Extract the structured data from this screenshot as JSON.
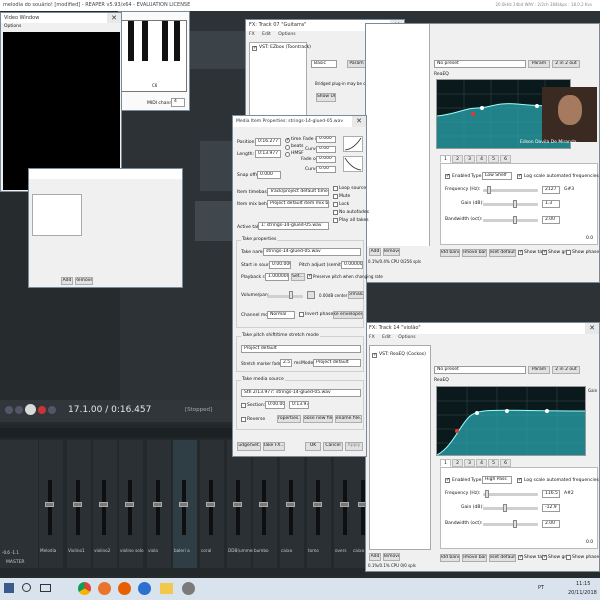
{
  "reaper_title": "melodia do souário! [modified] - REAPER v5.93/x64 - EVALUATION LICENSE",
  "reaper_status_right": "20.0kHz 24bit WAV : 2/2ch 384kbps : 18.0.2 Kvs",
  "video_window": {
    "title": "Video Window",
    "menu": "Options"
  },
  "midi_window": {
    "channel_label": "MIDI channel:",
    "channel_value": "4",
    "key_label": "C6"
  },
  "small_panel": {
    "add": "Add",
    "remove": "Remove"
  },
  "transport": {
    "position": "17.1.00 / 0:16.457",
    "state": "[Stopped]"
  },
  "mixer": {
    "tracks": [
      "Melodia",
      "Violino1",
      "violino2",
      "violino solo",
      "viola",
      "baleri a",
      "coral",
      "DDB(ummer",
      "bumbo",
      "caixa",
      "tomo",
      "overs",
      "caixa"
    ],
    "master_label": "MASTER",
    "master_db": "-0.6 -1.1"
  },
  "fx1": {
    "title": "FX: Track 07 \"Guitarra\"",
    "menu": [
      "FX",
      "Edit",
      "Options"
    ],
    "plugin": "VST: EZbox (Toontrack)",
    "preset": "Basic",
    "param_btn": "Param",
    "io_btn": "2 in 2 out",
    "notice": "Bridged plug-in may be open in top level",
    "show_ui": "Show UI",
    "add": "Add",
    "remove": "Remove",
    "cpu": "0.1% CPU 0/256 spls"
  },
  "fx2": {
    "preset": "No preset",
    "param_btn": "Param",
    "io_btn": "2 in 2 out",
    "plugin_name": "ReaEQ",
    "webcam_caption": "Edson Davila De Miranda",
    "tabs": [
      "1",
      "2",
      "3",
      "4",
      "5",
      "6"
    ],
    "enabled_label": "Enabled",
    "type_label": "Type:",
    "type_value": "Low Shelf",
    "log_scale_label": "Log scale automated frequencies",
    "freq_label": "Frequency (Hz):",
    "freq_value": "2127",
    "freq_note": "G#3",
    "gain_label": "Gain (dB):",
    "gain_value": "1.3",
    "bw_label": "Bandwidth (oct):",
    "bw_value": "2.00",
    "add_band": "Add band",
    "remove_band": "Remove band",
    "reset_defaults": "Reset defaults",
    "show_tabs": "Show tabs",
    "show_grid": "Show grid",
    "show_phase": "Show phase",
    "value_right": "0.0",
    "add": "Add",
    "remove": "Remove",
    "cpu": "0.1%/0.4% CPU 0/256 spls"
  },
  "fx3": {
    "title": "FX: Track 14 \"violão\"",
    "menu": [
      "FX",
      "Edit",
      "Options"
    ],
    "plugin": "VST: ReaEQ (Cockos)",
    "preset": "No preset",
    "param_btn": "Param",
    "io_btn": "2 in 2 out",
    "plugin_name": "ReaEQ",
    "gain_side": "Gain",
    "tabs": [
      "1",
      "2",
      "3",
      "4",
      "5",
      "6"
    ],
    "enabled_label": "Enabled",
    "type_label": "Type:",
    "type_value": "High Pass",
    "log_scale_label": "Log scale automated frequencies",
    "freq_label": "Frequency (Hz):",
    "freq_value": "116.5",
    "freq_note": "A#2",
    "gain_label": "Gain (dB):",
    "gain_value": "-12.9",
    "bw_label": "Bandwidth (oct):",
    "bw_value": "2.00",
    "add_band": "Add band",
    "remove_band": "Remove band",
    "reset_defaults": "Reset defaults",
    "show_tabs": "Show tabs",
    "show_grid": "Show grid",
    "show_phase": "Show phase",
    "value_right": "0.0",
    "add": "Add",
    "remove": "Remove",
    "cpu": "0.1%/0.1% CPU 0/0 spls"
  },
  "media": {
    "title": "Media Item Properties: strings-14-glued-05.wav",
    "position_label": "Position:",
    "position_value": "0:16.277",
    "length_label": "Length:",
    "length_value": "0:13.977",
    "snap_label": "Snap offset:",
    "snap_value": "0.000",
    "fade_in_label": "Fade in:",
    "fade_in_value": "0.000",
    "curve_label": "Curve:",
    "curve_value": "0.00",
    "fade_out_label": "Fade out:",
    "fade_out_value": "0.000",
    "radio_time": "time",
    "radio_beats": "beats",
    "radio_hmsf": "HMSF",
    "timebase_label": "Item timebase:",
    "timebase_value": "Track/project default timebase",
    "mixbeh_label": "Item mix behavior:",
    "mixbeh_value": "Project default item mix behavior",
    "active_take_label": "Active take:",
    "active_take_value": "1: strings-14-glued-05.wav",
    "loop_source": "Loop source",
    "mute": "Mute",
    "lock": "Lock",
    "no_autofades": "No autofades",
    "play_all_takes": "Play all takes",
    "take_props_title": "Take properties",
    "take_name_label": "Take name:",
    "take_name_value": "strings-14-glued-05.wav",
    "start_label": "Start in source:",
    "start_value": "0:00.000",
    "pitch_label": "Pitch adjust (semitones):",
    "pitch_value": "0.000000",
    "rate_label": "Playback rate:",
    "rate_value": "1.000000",
    "set_btn": "Set...",
    "preserve_pitch": "Preserve pitch when changing rate",
    "vol_label": "Volume/pan:",
    "vol_value": "0.00dB center",
    "normalize": "Normalize",
    "channel_label": "Channel mode:",
    "channel_value": "Normal",
    "invert_phase": "Invert phase",
    "take_env": "Take envelopes...",
    "pitch_shift_title": "Take pitch shift/time stretch mode",
    "pitch_mode_value": "Project default",
    "stretch_label": "Stretch marker fade size:",
    "stretch_value": "2.5",
    "stretch_unit": "ms",
    "smode_label": "Mode:",
    "smode_value": "Project default",
    "source_title": "Take media source",
    "source_value": "Sth 2/13.977: strings-14-glued-05.wav",
    "section_label": "Section:",
    "section_v1": "0:00.000",
    "section_v2": "0:13.977",
    "reverse_label": "Reverse",
    "properties_btn": "Properties...",
    "choose_btn": "Choose new file...",
    "rename_btn": "Rename file...",
    "nudge": "Nudge/Set...",
    "take_fx": "Take FX...",
    "ok": "OK",
    "cancel": "Cancel",
    "apply": "Apply"
  },
  "taskbar": {
    "lang": "PT",
    "time": "11:15",
    "date": "20/11/2018"
  }
}
